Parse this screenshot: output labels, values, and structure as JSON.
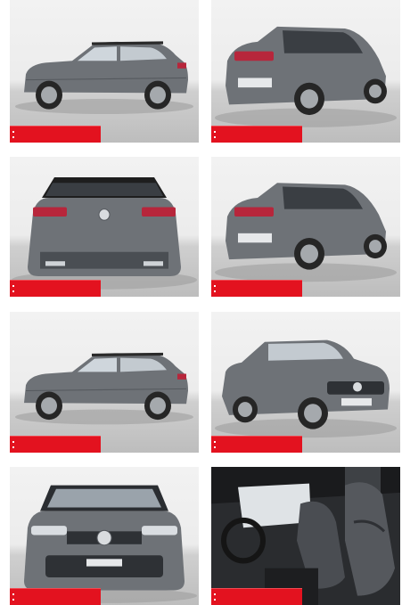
{
  "gallery": {
    "accent_color": "#e3121f",
    "car_color": "#6e7277",
    "images": [
      {
        "view": "side-profile-left"
      },
      {
        "view": "rear-three-quarter-right"
      },
      {
        "view": "rear"
      },
      {
        "view": "rear-three-quarter-left"
      },
      {
        "view": "side-profile-left"
      },
      {
        "view": "front-three-quarter-left"
      },
      {
        "view": "front"
      },
      {
        "view": "interior-front-seats"
      }
    ]
  }
}
